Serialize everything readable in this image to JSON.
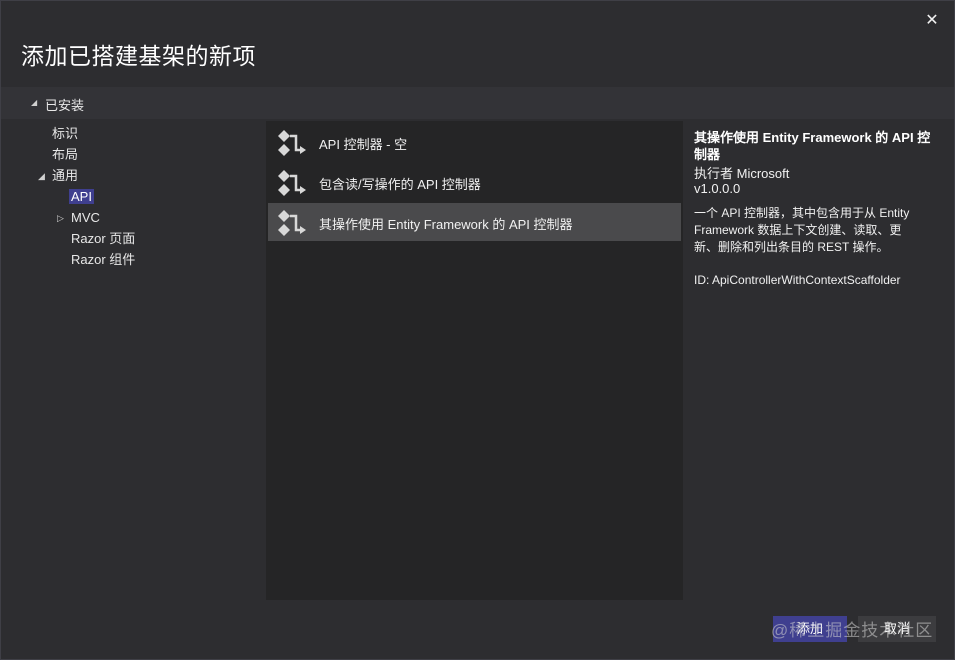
{
  "dialog": {
    "title": "添加已搭建基架的新项",
    "close_glyph": "✕"
  },
  "installed": {
    "label": "已安装"
  },
  "tree": {
    "items": [
      {
        "label": "标识"
      },
      {
        "label": "布局"
      },
      {
        "label": "通用"
      },
      {
        "label": "API"
      },
      {
        "label": "MVC"
      },
      {
        "label": "Razor 页面"
      },
      {
        "label": "Razor 组件"
      }
    ]
  },
  "templates": [
    {
      "label": "API 控制器 - 空"
    },
    {
      "label": "包含读/写操作的 API 控制器"
    },
    {
      "label": "其操作使用 Entity Framework 的 API 控制器"
    }
  ],
  "detail": {
    "title": "其操作使用 Entity Framework 的 API 控制器",
    "author": "执行者 Microsoft",
    "version": "v1.0.0.0",
    "description": "一个 API 控制器，其中包含用于从 Entity Framework 数据上下文创建、读取、更新、删除和列出条目的 REST 操作。",
    "id": "ID: ApiControllerWithContextScaffolder"
  },
  "footer": {
    "add_label": "添加",
    "cancel_label": "取消"
  },
  "watermark": "@稀土掘金技术社区",
  "colors": {
    "selection": "#3f3f8f",
    "list_bg": "#252526",
    "dialog_bg": "#2d2d30"
  }
}
